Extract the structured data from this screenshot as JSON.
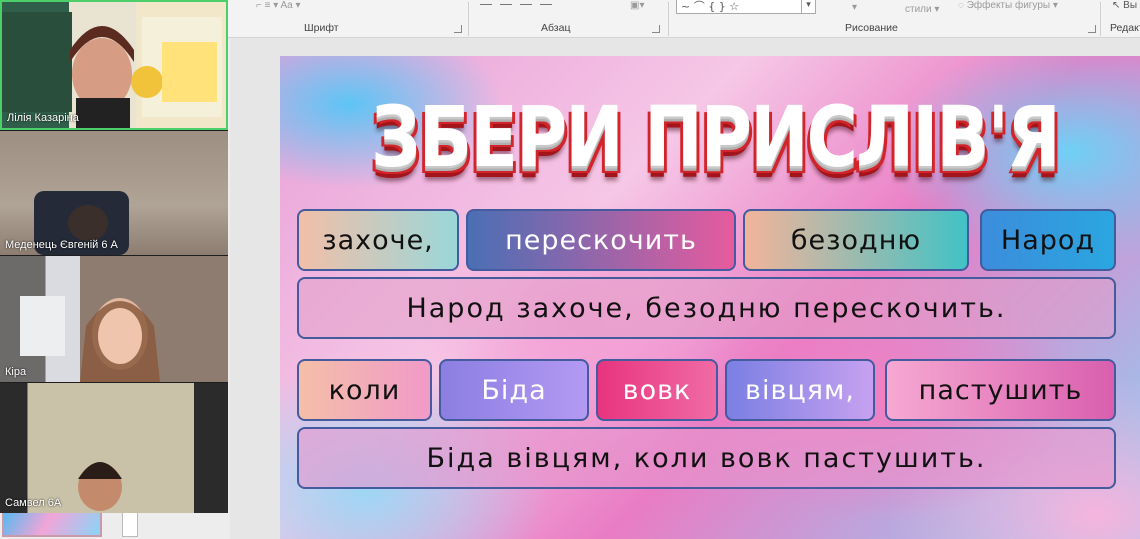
{
  "ribbon": {
    "groups": [
      {
        "label": "Шрифт"
      },
      {
        "label": "Абзац"
      },
      {
        "label": "Рисование"
      },
      {
        "label": "Редакт"
      }
    ],
    "styles_label": "стили",
    "effects_label": "Эффекты фигуры",
    "select_label": "Вы"
  },
  "participants": [
    {
      "name": "Лілія Казаріна",
      "active": true
    },
    {
      "name": "Меденець Євгеній 6 А",
      "active": false
    },
    {
      "name": "Кіра",
      "active": false
    },
    {
      "name": "Самвел 6А",
      "active": false
    }
  ],
  "slide": {
    "title": "ЗБЕРИ ПРИСЛІВ'Я",
    "row1_words": [
      "захоче,",
      "перескочить",
      "безодню",
      "Народ"
    ],
    "row1_sentence": "Народ захоче, безодню перескочить.",
    "row2_words": [
      "коли",
      "Біда",
      "вовк",
      "вівцям,",
      "пастушить"
    ],
    "row2_sentence": "Біда вівцям, коли вовк пастушить."
  },
  "colors": {
    "active_speaker_border": "#4ccf6a",
    "title_shadow": "#d2252b",
    "box_border": "#445b9e"
  }
}
